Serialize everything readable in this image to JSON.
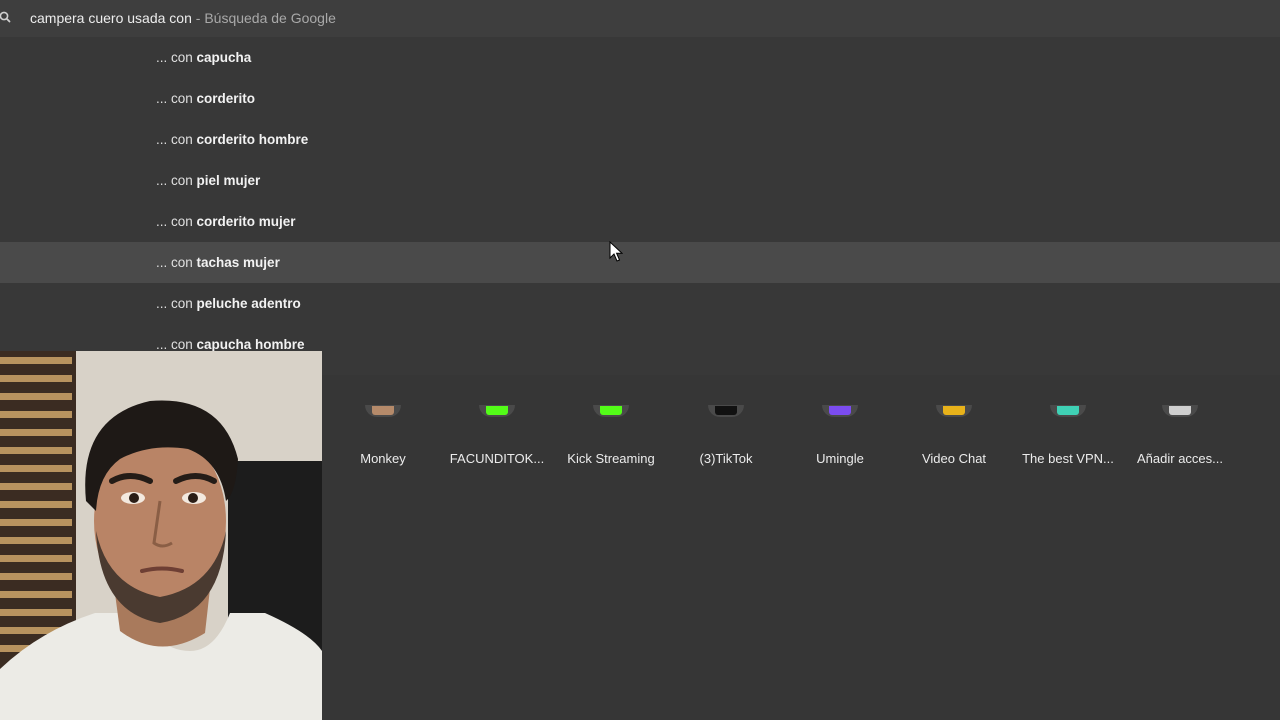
{
  "omnibox": {
    "typed": "campera cuero usada con",
    "suffix": " - Búsqueda de Google",
    "icon": "search-icon"
  },
  "suggestions": [
    {
      "prefix": "... con ",
      "completion": "capucha",
      "hovered": false
    },
    {
      "prefix": "... con ",
      "completion": "corderito",
      "hovered": false
    },
    {
      "prefix": "... con ",
      "completion": "corderito hombre",
      "hovered": false
    },
    {
      "prefix": "... con ",
      "completion": "piel mujer",
      "hovered": false
    },
    {
      "prefix": "... con ",
      "completion": "corderito mujer",
      "hovered": false
    },
    {
      "prefix": "... con ",
      "completion": "tachas mujer",
      "hovered": true
    },
    {
      "prefix": "... con ",
      "completion": "peluche adentro",
      "hovered": false
    },
    {
      "prefix": "... con ",
      "completion": "capucha hombre",
      "hovered": false
    }
  ],
  "shortcuts": [
    {
      "label": "Monkey",
      "icon": "monkey-icon",
      "color": "#b58a6a"
    },
    {
      "label": "FACUNDITOK...",
      "icon": "kick-icon",
      "color": "#53fc18"
    },
    {
      "label": "Kick Streaming",
      "icon": "kick-icon",
      "color": "#53fc18"
    },
    {
      "label": "(3)TikTok",
      "icon": "tiktok-icon",
      "color": "#111111"
    },
    {
      "label": "Umingle",
      "icon": "umingle-icon",
      "color": "#7b4cf0"
    },
    {
      "label": "Video Chat",
      "icon": "video-chat-icon",
      "color": "#e8b21a"
    },
    {
      "label": "The best VPN...",
      "icon": "vpn-icon",
      "color": "#3fd1b5"
    },
    {
      "label": "Añadir acces...",
      "icon": "add-shortcut-icon",
      "color": "#cfcfcf"
    }
  ],
  "theme": {
    "background": "#363636",
    "omnibox_bg": "#3e3e3e",
    "hover_bg": "#4a4a4a"
  }
}
